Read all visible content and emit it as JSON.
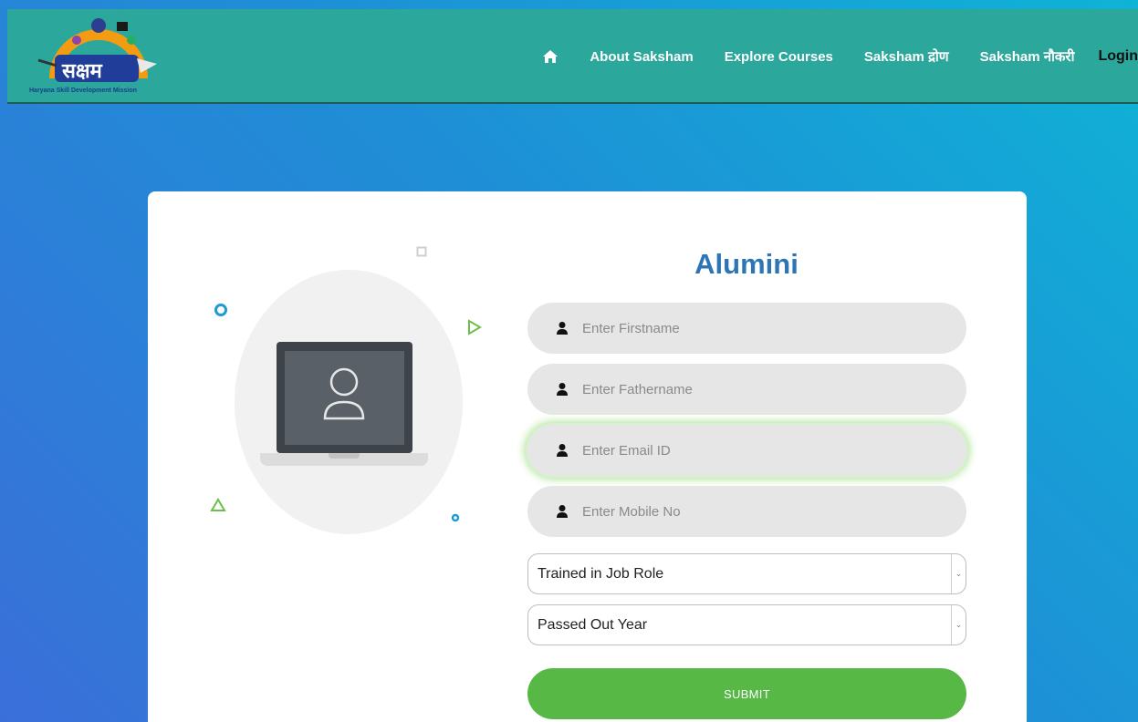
{
  "header": {
    "logo_text": "सक्षम",
    "logo_tagline": "Haryana Skill Development Mission",
    "nav": [
      {
        "label": "About Saksham"
      },
      {
        "label": "Explore Courses"
      },
      {
        "label": "Saksham द्रोण"
      },
      {
        "label": "Saksham नौकरी"
      },
      {
        "label": "Login"
      }
    ],
    "home_icon": "home-icon"
  },
  "form": {
    "title": "Alumini",
    "fields": [
      {
        "placeholder": "Enter Firstname",
        "value": ""
      },
      {
        "placeholder": "Enter Fathername",
        "value": ""
      },
      {
        "placeholder": "Enter Email ID",
        "value": ""
      },
      {
        "placeholder": "Enter Mobile No",
        "value": ""
      }
    ],
    "selects": [
      {
        "value": "Trained in Job Role"
      },
      {
        "value": "Passed Out Year"
      }
    ],
    "submit_label": "SUBMIT"
  },
  "colors": {
    "header_bg": "#2ba79c",
    "title": "#2e75b6",
    "submit": "#57b846",
    "focus_glow": "#a8e08f"
  }
}
